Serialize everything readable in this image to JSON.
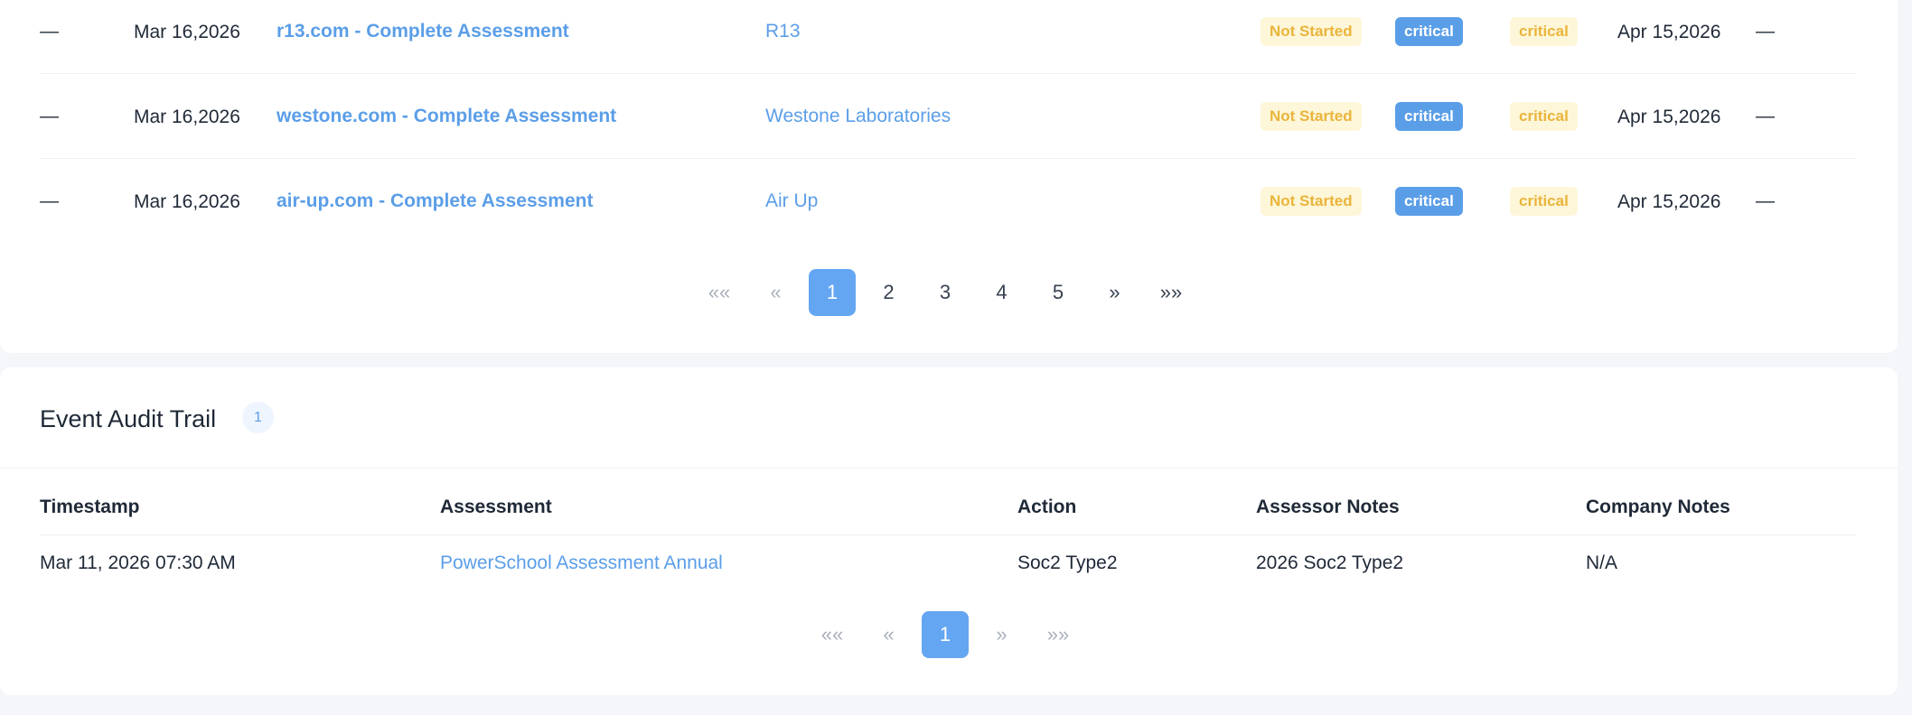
{
  "assessments": {
    "rows": [
      {
        "first": "—",
        "date_line1": "Mar 16,",
        "date_line2": "2026",
        "title": "r13.com - Complete Assessment",
        "company": "R13",
        "status": "Not Started",
        "priority": "critical",
        "risk": "critical",
        "due_line1": "Apr 15,",
        "due_line2": "2026",
        "last": "—"
      },
      {
        "first": "—",
        "date_line1": "Mar 16,",
        "date_line2": "2026",
        "title": "westone.com - Complete Assessment",
        "company": "Westone Laboratories",
        "status": "Not Started",
        "priority": "critical",
        "risk": "critical",
        "due_line1": "Apr 15,",
        "due_line2": "2026",
        "last": "—"
      },
      {
        "first": "—",
        "date_line1": "Mar 16,",
        "date_line2": "2026",
        "title": "air-up.com - Complete Assessment",
        "company": "Air Up",
        "status": "Not Started",
        "priority": "critical",
        "risk": "critical",
        "due_line1": "Apr 15,",
        "due_line2": "2026",
        "last": "—"
      }
    ],
    "pagination": {
      "first": "««",
      "prev": "«",
      "pages": [
        "1",
        "2",
        "3",
        "4",
        "5"
      ],
      "next": "»",
      "last": "»»",
      "current": "1"
    }
  },
  "audit": {
    "title": "Event Audit Trail",
    "count": "1",
    "columns": [
      "Timestamp",
      "Assessment",
      "Action",
      "Assessor Notes",
      "Company Notes"
    ],
    "rows": [
      {
        "timestamp": "Mar 11, 2026 07:30 AM",
        "assessment": "PowerSchool Assessment Annual",
        "action": "Soc2 Type2",
        "assessor_notes": "2026 Soc2 Type2",
        "company_notes": "N/A"
      }
    ],
    "pagination": {
      "first": "««",
      "prev": "«",
      "pages": [
        "1"
      ],
      "next": "»",
      "last": "»»",
      "current": "1"
    }
  },
  "colors": {
    "accent": "#5b9ee8",
    "active_page": "#64a6f1",
    "badge_warning_bg": "#fef6d8",
    "badge_warning_text": "#e9b53c",
    "page_bg": "#f4f6f9"
  }
}
